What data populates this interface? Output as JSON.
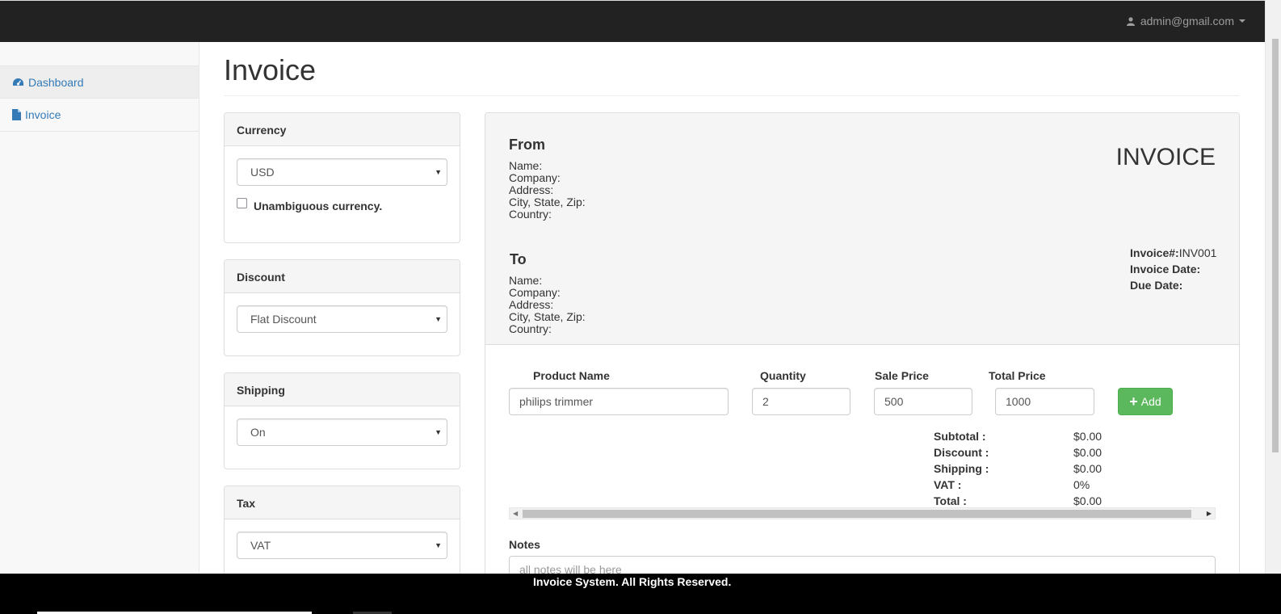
{
  "topbar": {
    "user_email": "admin@gmail.com"
  },
  "sidebar": {
    "items": [
      {
        "label": "Dashboard",
        "icon": "dashboard-icon"
      },
      {
        "label": "Invoice",
        "icon": "file-icon"
      }
    ]
  },
  "page": {
    "title": "Invoice"
  },
  "panels": {
    "currency": {
      "title": "Currency",
      "selected": "USD",
      "checkbox_label": "Unambiguous currency."
    },
    "discount": {
      "title": "Discount",
      "selected": "Flat Discount"
    },
    "shipping": {
      "title": "Shipping",
      "selected": "On"
    },
    "tax": {
      "title": "Tax",
      "selected": "VAT"
    }
  },
  "invoice": {
    "heading": "INVOICE",
    "from": {
      "title": "From",
      "lines": [
        "Name:",
        "Company:",
        "Address:",
        "City, State, Zip:",
        "Country:"
      ]
    },
    "to": {
      "title": "To",
      "lines": [
        "Name:",
        "Company:",
        "Address:",
        "City, State, Zip:",
        "Country:"
      ]
    },
    "meta": {
      "number_label": "Invoice#:",
      "number": "INV001",
      "date_label": "Invoice Date:",
      "due_label": "Due Date:"
    },
    "columns": {
      "product": "Product Name",
      "quantity": "Quantity",
      "sale_price": "Sale Price",
      "total_price": "Total Price"
    },
    "item": {
      "product": "philips trimmer",
      "quantity": "2",
      "sale_price": "500",
      "total_price": "1000"
    },
    "add_label": "Add",
    "totals": [
      {
        "label": "Subtotal :",
        "value": "$0.00"
      },
      {
        "label": "Discount :",
        "value": "$0.00"
      },
      {
        "label": "Shipping :",
        "value": "$0.00"
      },
      {
        "label": "VAT :",
        "value": "0%"
      },
      {
        "label": "Total :",
        "value": "$0.00"
      }
    ],
    "notes_label": "Notes",
    "notes_placeholder": "all notes will be here"
  },
  "footer": {
    "text": "Invoice System. All Rights Reserved."
  },
  "colors": {
    "topbar": "#222222",
    "link": "#337ab7",
    "add_button": "#5cb85c",
    "footer": "#000000"
  }
}
